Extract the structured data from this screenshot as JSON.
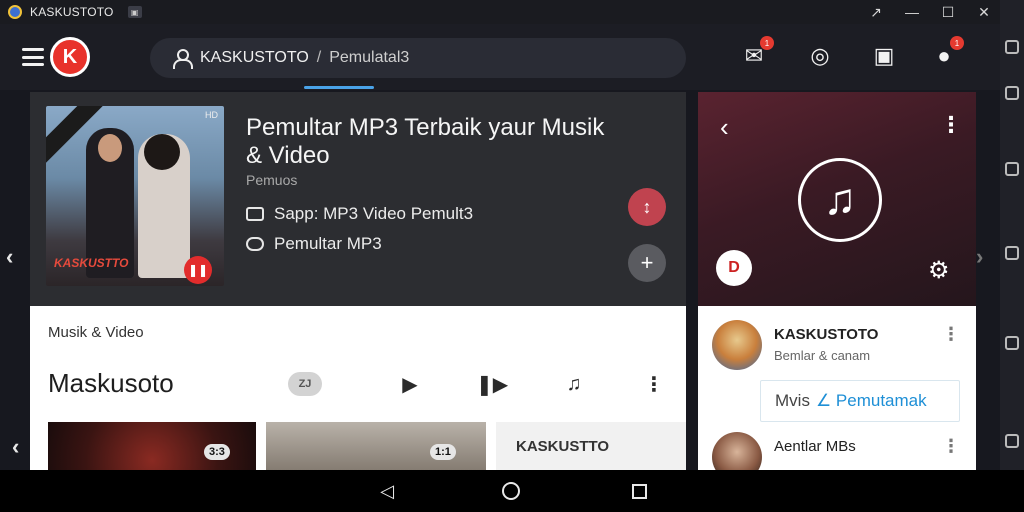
{
  "window": {
    "title": "KASKUSTOTO",
    "controls": [
      "↗",
      "—",
      "☐",
      "✕"
    ]
  },
  "header": {
    "logo_letter": "K",
    "breadcrumb": {
      "root": "KASKUSTOTO",
      "separator": "/",
      "current": "Pemulatal3"
    },
    "icons": [
      {
        "name": "chat-icon",
        "glyph": "✉",
        "badge": "1"
      },
      {
        "name": "headset-icon",
        "glyph": "◎",
        "badge": ""
      },
      {
        "name": "bag-icon",
        "glyph": "▣",
        "badge": ""
      },
      {
        "name": "profile-icon",
        "glyph": "●",
        "badge": "1"
      }
    ]
  },
  "hero": {
    "title": "Pemultar MP3 Terbaik yaur Musik & Video",
    "subtitle": "Pemuos",
    "row1": "Sapp: MP3 Video Pemult3",
    "row2": "Pemultar MP3",
    "art_label": "KASKUSTTO",
    "art_corner": "HD",
    "fab_red": "↕",
    "fab_gray": "+"
  },
  "lower": {
    "section": "Musik & Video",
    "heading": "Maskusoto",
    "tool_pill": "ZJ",
    "tools": [
      "▶",
      "❚▶",
      "♫",
      "⋮"
    ],
    "thumbs": [
      {
        "duration": "3:3"
      },
      {
        "duration": "1:1"
      },
      {
        "title": "KASKUSTTO"
      }
    ]
  },
  "right_panel": {
    "back": "‹",
    "more": "⋮",
    "note": "♫",
    "chip": "D",
    "gear": "⚙",
    "contacts": [
      {
        "name": "KASKUSTOTO",
        "status": "Bemlar & canam"
      },
      {
        "name": "Aentlar MBs",
        "status": ""
      }
    ],
    "field_left": "Mvis",
    "field_right": "∠ Pemutamak"
  },
  "nav": {
    "back": "◁"
  },
  "colors": {
    "brand": "#e8322b",
    "accent": "#4aa3e8",
    "link": "#1e8fd6"
  }
}
